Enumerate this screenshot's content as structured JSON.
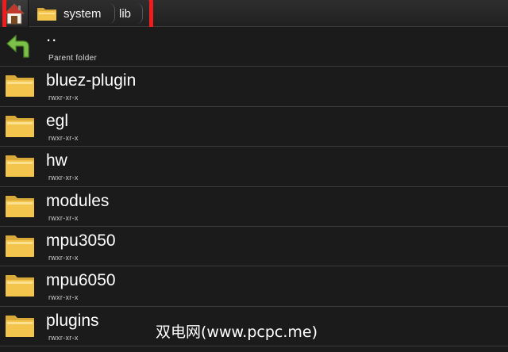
{
  "breadcrumb": {
    "home_icon": "home-icon",
    "items": [
      {
        "label": "system",
        "icon": "folder-icon"
      },
      {
        "label": "lib"
      }
    ],
    "highlight_color": "#ee1c1c"
  },
  "parent": {
    "name": "..",
    "subtitle": "Parent folder",
    "icon": "back-arrow-icon"
  },
  "items": [
    {
      "name": "bluez-plugin",
      "perm": "rwxr-xr-x"
    },
    {
      "name": "egl",
      "perm": "rwxr-xr-x"
    },
    {
      "name": "hw",
      "perm": "rwxr-xr-x"
    },
    {
      "name": "modules",
      "perm": "rwxr-xr-x"
    },
    {
      "name": "mpu3050",
      "perm": "rwxr-xr-x"
    },
    {
      "name": "mpu6050",
      "perm": "rwxr-xr-x"
    },
    {
      "name": "plugins",
      "perm": "rwxr-xr-x"
    }
  ],
  "watermark": "双电网(www.pcpc.me)",
  "colors": {
    "background": "#1b1b1b",
    "folder": "#f2c14a",
    "arrow": "#7cc04a"
  }
}
